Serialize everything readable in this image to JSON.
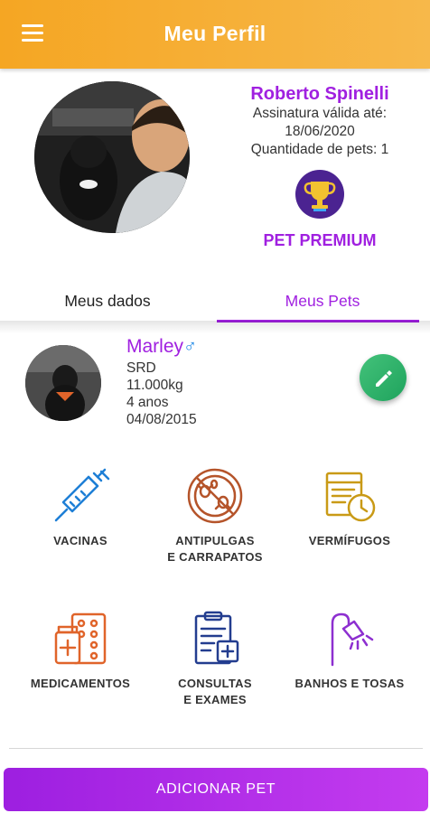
{
  "appbar": {
    "title": "Meu Perfil"
  },
  "profile": {
    "name": "Roberto Spinelli",
    "subscription_label": "Assinatura válida até:",
    "subscription_date": "18/06/2020",
    "pets_count": "Quantidade de pets: 1",
    "plan": "PET PREMIUM"
  },
  "tabs": [
    {
      "label": "Meus dados"
    },
    {
      "label": "Meus Pets"
    }
  ],
  "pet": {
    "name": "Marley",
    "gender_symbol": "♂",
    "breed": "SRD",
    "weight": "11.000kg",
    "age": "4 anos",
    "birth_date": "04/08/2015"
  },
  "features": {
    "vacinas": [
      "VACINAS"
    ],
    "antipulgas": [
      "ANTIPULGAS",
      "E CARRAPATOS"
    ],
    "vermifugos": [
      "VERMÍFUGOS"
    ],
    "medicamentos": [
      "MEDICAMENTOS"
    ],
    "consultas": [
      "CONSULTAS",
      "E EXAMES"
    ],
    "banhos": [
      "BANHOS E TOSAS"
    ]
  },
  "actions": {
    "add_pet": "ADICIONAR PET"
  },
  "colors": {
    "appbar": "#f5a623",
    "brand_purple": "#a020e0",
    "fab_green": "#2eb36c",
    "icon_blue": "#1e7fd6",
    "icon_brown": "#b5542a",
    "icon_gold": "#c99a16",
    "icon_orange": "#e0642a",
    "icon_navy": "#233d8f",
    "icon_violet": "#8d2fd0"
  },
  "icons": {
    "menu": "menu-icon",
    "trophy": "trophy-icon",
    "edit": "pencil-icon",
    "vacinas": "syringe-icon",
    "antipulgas": "no-bugs-icon",
    "vermifugos": "calendar-clock-icon",
    "medicamentos": "medicine-icon",
    "consultas": "clipboard-icon",
    "banhos": "shower-icon"
  }
}
